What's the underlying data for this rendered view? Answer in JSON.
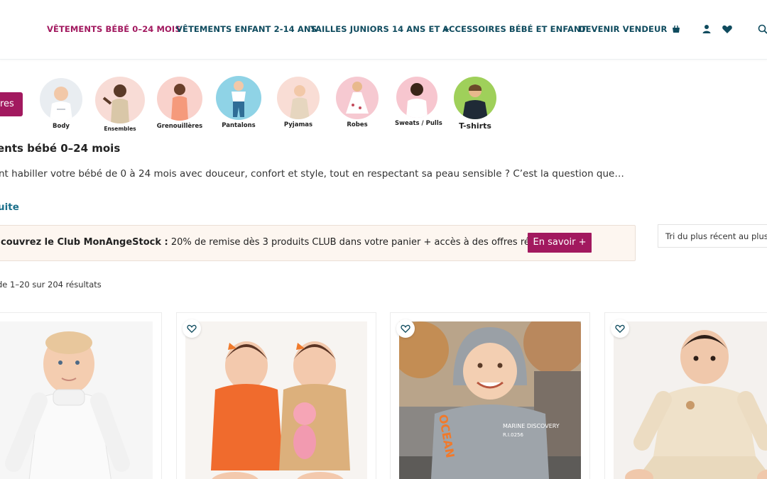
{
  "nav": {
    "items": [
      {
        "label": "VÊTEMENTS BÉBÉ 0–24 MOIS",
        "active": true
      },
      {
        "label": "VÊTEMENTS ENFANT 2-14 ANS",
        "active": false
      },
      {
        "label": "TAILLES JUNIORS 14 ANS ET +",
        "active": false
      },
      {
        "label": "ACCESSOIRES BÉBÉ ET ENFANT",
        "active": false
      },
      {
        "label": "DEVENIR VENDEUR",
        "active": false
      }
    ],
    "icons": [
      "cart-icon",
      "user-icon",
      "heart-icon",
      "search-icon"
    ]
  },
  "filter": {
    "label": "res"
  },
  "categories": [
    {
      "label": "Body",
      "bg": "#e9edf1"
    },
    {
      "label": "Ensembles",
      "bg": "#f8dcd6"
    },
    {
      "label": "Grenouillères",
      "bg": "#f9d2cc"
    },
    {
      "label": "Pantalons",
      "bg": "#8fd3e6"
    },
    {
      "label": "Pyjamas",
      "bg": "#f9ddd5"
    },
    {
      "label": "Robes",
      "bg": "#f6c9d1"
    },
    {
      "label": "Sweats / Pulls",
      "bg": "#f7c6cf"
    },
    {
      "label": "T-shirts",
      "bg": "#9fd05a"
    }
  ],
  "page": {
    "title": "ents bébé 0–24 mois",
    "intro": "nt habiller votre bébé de 0 à 24 mois avec douceur, confort et style, tout en respectant sa peau sensible ? C’est la question que…",
    "read_more": "uite"
  },
  "club": {
    "bold": "couvrez le Club MonAngeStock :",
    "text": " 20% de remise dès 3 produits CLUB dans votre panier + accès à des offres réservées !",
    "button": "En savoir +"
  },
  "sort": {
    "label": "Tri du plus récent au plus an"
  },
  "results": {
    "text": "de 1–20 sur 204 résultats"
  },
  "products": [
    {
      "alt": "Body col roulé blanc",
      "bg": "#f6f6f6"
    },
    {
      "alt": "Bodies orange et beige",
      "bg": "#f7f4f1"
    },
    {
      "alt": "Sweat à capuche gris OCEAN",
      "print_main": "OCEAN",
      "print_chest": "MARINE DISCOVERY",
      "print_code": "R.I.0256"
    },
    {
      "alt": "Ensemble beige bébé",
      "bg": "#f4f1ee"
    }
  ],
  "colors": {
    "accent": "#a2195f",
    "nav": "#0f4b5e",
    "link": "#1a6f8a"
  }
}
